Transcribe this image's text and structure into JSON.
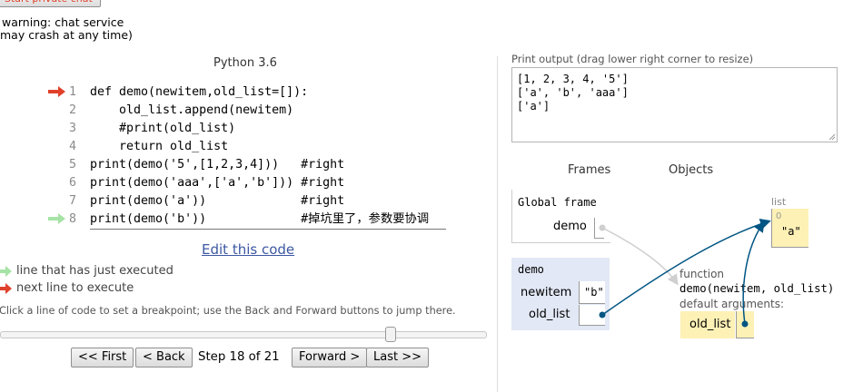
{
  "top": {
    "start_button": "Start private chat",
    "warning_line1": "warning: chat service",
    "warning_line2": "may crash at any time)"
  },
  "editor": {
    "language": "Python 3.6",
    "lines": [
      {
        "num": "1",
        "code": "def demo(newitem,old_list=[]):"
      },
      {
        "num": "2",
        "code": "    old_list.append(newitem)"
      },
      {
        "num": "3",
        "code": "    #print(old_list)"
      },
      {
        "num": "4",
        "code": "    return old_list"
      },
      {
        "num": "5",
        "code": "print(demo('5',[1,2,3,4]))   #right"
      },
      {
        "num": "6",
        "code": "print(demo('aaa',['a','b'])) #right"
      },
      {
        "num": "7",
        "code": "print(demo('a'))             #right"
      },
      {
        "num": "8",
        "code": "print(demo('b'))             #掉坑里了，参数要协调"
      }
    ],
    "edit_link": "Edit this code",
    "legend_executed": "line that has just executed",
    "legend_next": "next line to execute",
    "breakpoint_hint": "Click a line of code to set a breakpoint; use the Back and Forward buttons to jump there.",
    "slider_position": 0.8095,
    "nav": {
      "first": "<< First",
      "back": "< Back",
      "step_text": "Step 18 of 21",
      "forward": "Forward >",
      "last": "Last >>"
    }
  },
  "output": {
    "label": "Print output (drag lower right corner to resize)",
    "lines": [
      "[1, 2, 3, 4, '5']",
      "['a', 'b', 'aaa']",
      "['a']"
    ]
  },
  "visual": {
    "frames_header": "Frames",
    "objects_header": "Objects",
    "global_frame": {
      "title": "Global frame",
      "var_name": "demo"
    },
    "demo_frame": {
      "title": "demo",
      "vars": [
        {
          "name": "newitem",
          "value": "\"b\""
        },
        {
          "name": "old_list",
          "value": ""
        }
      ]
    },
    "list_object": {
      "label": "list",
      "index": "0",
      "value": "\"a\""
    },
    "function_object": {
      "label": "function",
      "signature": "demo(newitem, old_list)",
      "defaults_label": "default arguments:",
      "default_name": "old_list"
    }
  },
  "colors": {
    "arrow_red": "#e0412b",
    "arrow_green": "#a6e3a6",
    "frame_bg": "#e2e8f5",
    "object_bg": "#fdf1b6",
    "pointer_line": "#005583"
  }
}
